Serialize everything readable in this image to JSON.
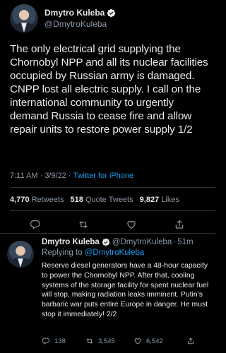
{
  "main_tweet": {
    "author_name": "Dmytro Kuleba",
    "handle": "@DmytroKuleba",
    "text": "The only electrical grid supplying the Chornobyl NPP and all its nuclear facilities occupied by Russian army is damaged. CNPP lost all electric supply. I call on the international community to urgently demand Russia to cease fire and allow repair units to restore power supply 1/2",
    "time": "7:11 AM · 3/9/22 · ",
    "client": "Twitter for iPhone",
    "retweets_count": "4,770",
    "retweets_label": "Retweets",
    "quotes_count": "518",
    "quotes_label": "Quote Tweets",
    "likes_count": "9,827",
    "likes_label": "Likes"
  },
  "reply_tweet": {
    "author_name": "Dmytro Kuleba",
    "handle": "@DmytroKuleba",
    "separator": "·",
    "time": "51m",
    "replying_label": "Replying to ",
    "replying_to": "@DmytroKuleba",
    "text": "Reserve diesel generators have a 48-hour capacity to power the Chornobyl NPP. After that, cooling systems of the storage facility for spent nuclear fuel will stop, making radiation leaks imminent. Putin’s barbaric war puts entire Europe in danger. He must stop it immediately! 2/2",
    "replies": "138",
    "retweets": "3,545",
    "likes": "6,542"
  },
  "colors": {
    "background": "#000000",
    "text": "#e7e9ea",
    "secondary": "#8b98a5",
    "accent": "#1d9bf0",
    "divider": "#2f3336"
  },
  "icons": [
    "verified-badge-icon",
    "reply-icon",
    "retweet-icon",
    "like-icon",
    "share-icon"
  ]
}
